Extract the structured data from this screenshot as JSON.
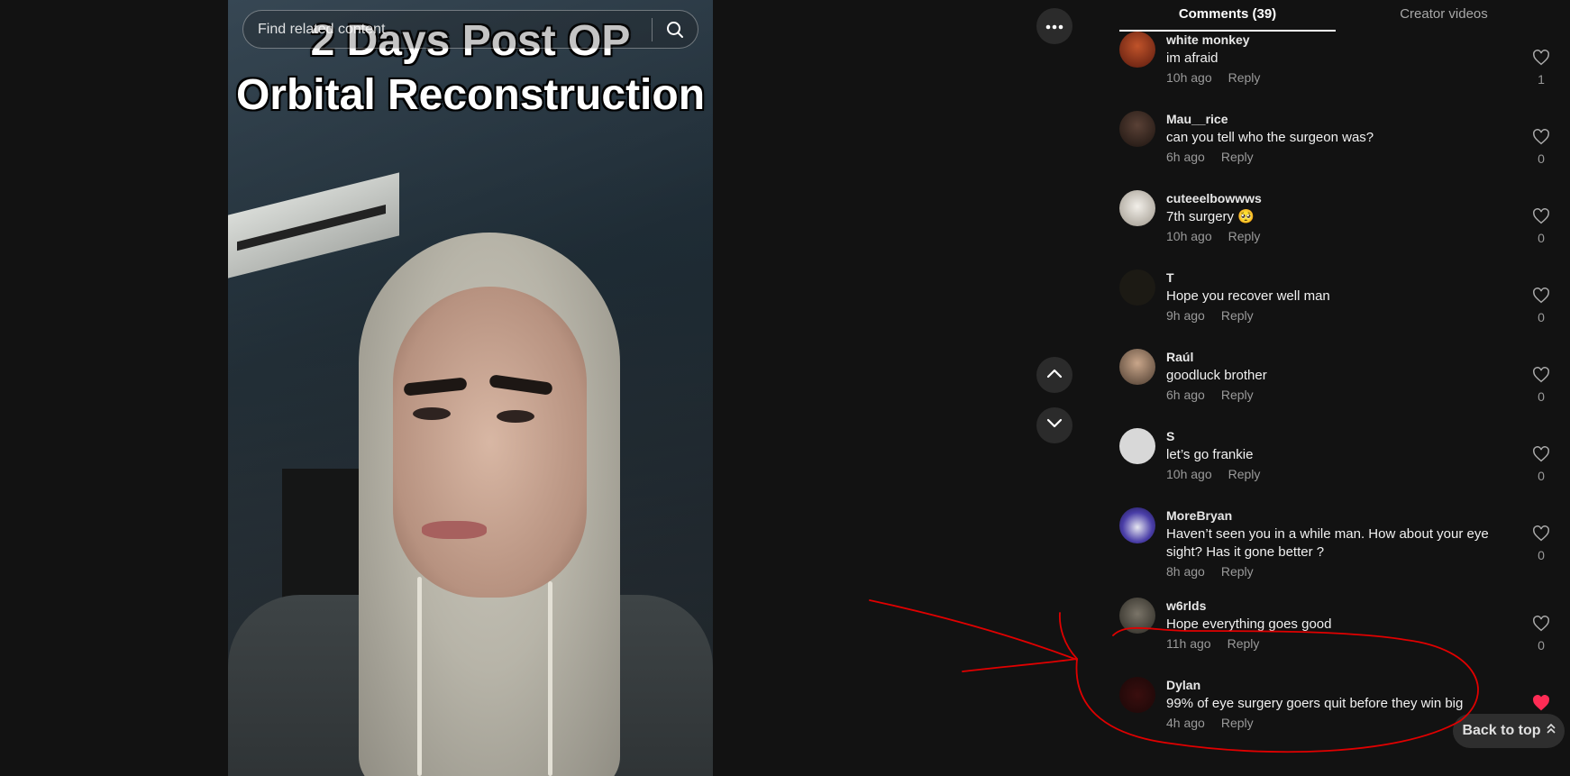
{
  "video": {
    "title_line1": "2 Days Post OP",
    "title_line2": "Orbital Reconstruction"
  },
  "search": {
    "placeholder": "Find related content",
    "icon": "search-icon"
  },
  "controls": {
    "more_icon": "more-horizontal-icon",
    "up_icon": "chevron-up-icon",
    "down_icon": "chevron-down-icon"
  },
  "tabs": [
    {
      "label": "Comments (39)",
      "active": true
    },
    {
      "label": "Creator videos",
      "active": false
    }
  ],
  "comments": [
    {
      "user": "white monkey",
      "text": "im afraid",
      "time": "10h ago",
      "reply": "Reply",
      "likes": "1",
      "liked": false
    },
    {
      "user": "Mau__rice",
      "text": "can you tell who the surgeon was?",
      "time": "6h ago",
      "reply": "Reply",
      "likes": "0",
      "liked": false
    },
    {
      "user": "cuteeelbowwws",
      "text": "7th surgery 🥺",
      "time": "10h ago",
      "reply": "Reply",
      "likes": "0",
      "liked": false
    },
    {
      "user": "T",
      "text": "Hope you recover well man",
      "time": "9h ago",
      "reply": "Reply",
      "likes": "0",
      "liked": false
    },
    {
      "user": "Raúl",
      "text": "goodluck brother",
      "time": "6h ago",
      "reply": "Reply",
      "likes": "0",
      "liked": false
    },
    {
      "user": "S",
      "text": "let’s go frankie",
      "time": "10h ago",
      "reply": "Reply",
      "likes": "0",
      "liked": false
    },
    {
      "user": "MoreBryan",
      "text": "Haven’t seen you in a while man. How about your eye sight? Has it gone better ?",
      "time": "8h ago",
      "reply": "Reply",
      "likes": "0",
      "liked": false
    },
    {
      "user": "w6rlds",
      "text": "Hope everything goes good",
      "time": "11h ago",
      "reply": "Reply",
      "likes": "0",
      "liked": false
    },
    {
      "user": "Dylan",
      "text": "99% of eye surgery goers quit before they win big",
      "time": "4h ago",
      "reply": "Reply",
      "likes": "",
      "liked": true
    }
  ],
  "back_to_top": {
    "label": "Back to top",
    "icon": "double-chevron-up-icon"
  },
  "colors": {
    "background": "#121212",
    "liked_heart": "#fe2c55",
    "annotation": "#e00000"
  }
}
